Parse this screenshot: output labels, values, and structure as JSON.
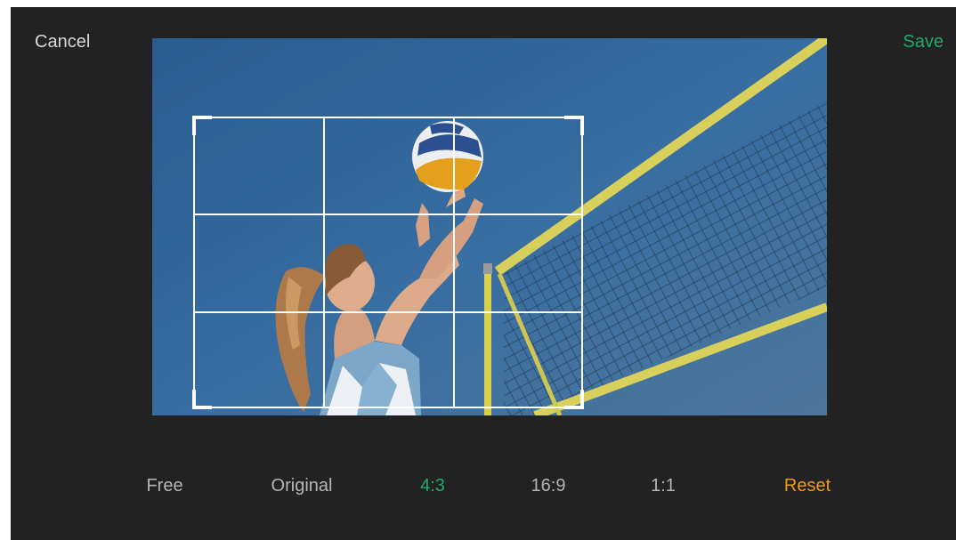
{
  "header": {
    "cancel_label": "Cancel",
    "save_label": "Save"
  },
  "ratio_bar": {
    "options": [
      "Free",
      "Original",
      "4:3",
      "16:9",
      "1:1"
    ],
    "selected": "4:3",
    "reset_label": "Reset"
  },
  "colors": {
    "background": "#222222",
    "accent_green": "#1faa6a",
    "reset_orange": "#f29a1c",
    "inactive_text": "#b5b5b5",
    "crop_frame": "#ffffff"
  }
}
